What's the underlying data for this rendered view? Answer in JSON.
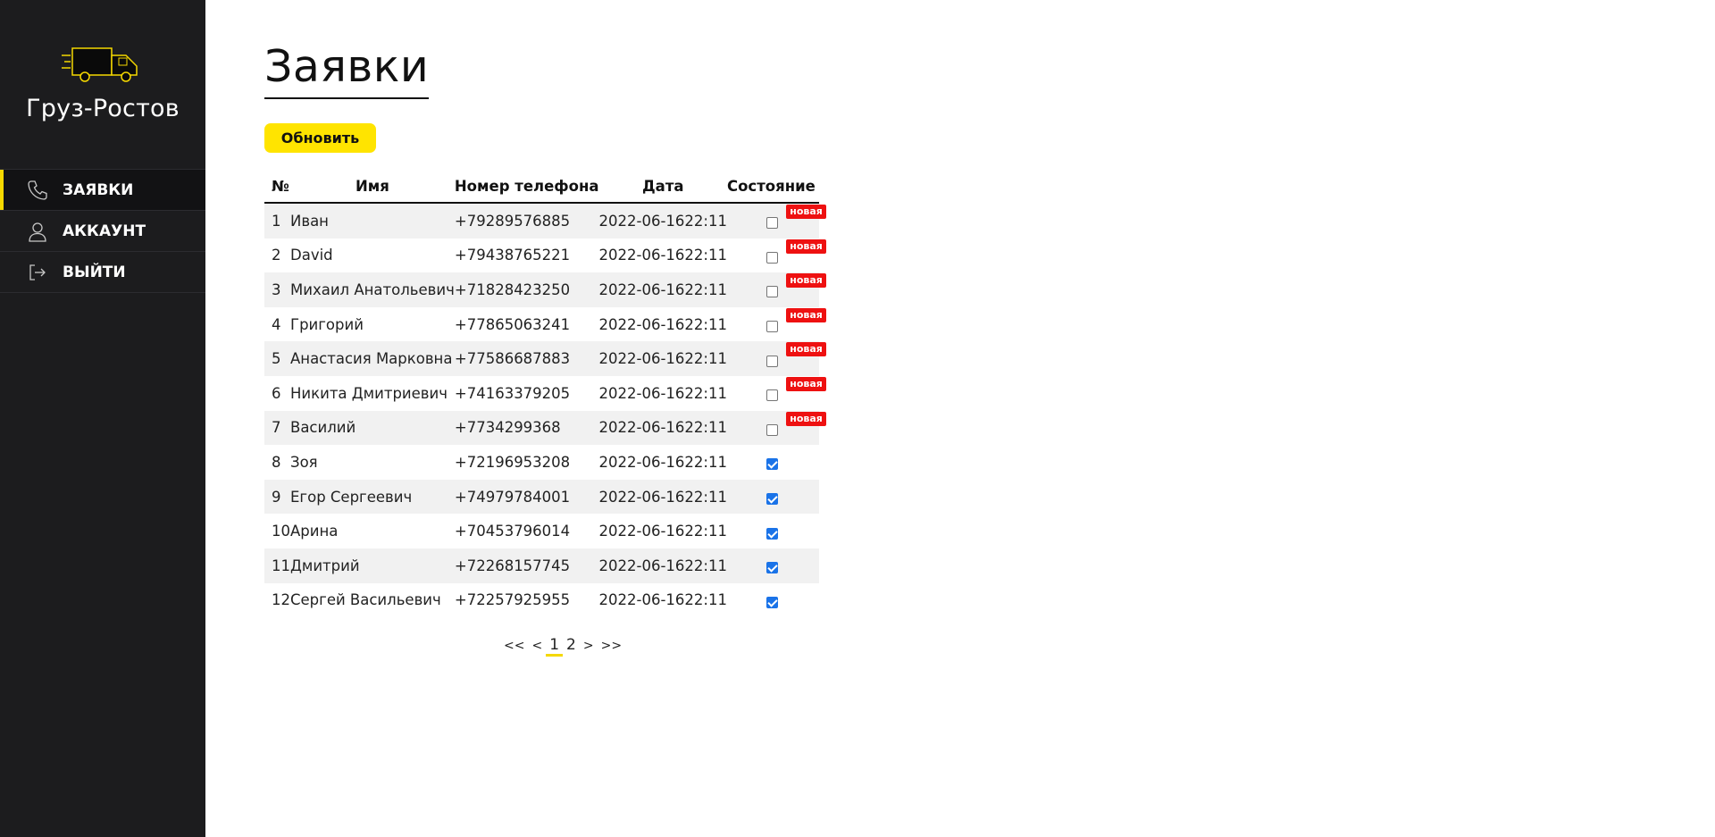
{
  "app": {
    "brand_name": "Груз-Ростов",
    "accent_color": "#f5d800",
    "sidebar_bg": "#1c1c1e"
  },
  "sidebar": {
    "items": [
      {
        "label": "ЗАЯВКИ",
        "icon": "phone-icon",
        "active": true
      },
      {
        "label": "АККАУНТ",
        "icon": "user-icon",
        "active": false
      },
      {
        "label": "ВЫЙТИ",
        "icon": "logout-icon",
        "active": false
      }
    ]
  },
  "main": {
    "title": "Заявки",
    "refresh_label": "Обновить",
    "table": {
      "headers": {
        "num": "№",
        "name": "Имя",
        "phone": "Номер телефона",
        "date": "Дата",
        "state": "Состояние"
      },
      "new_badge_label": "новая",
      "rows": [
        {
          "num": "1",
          "name": "Иван",
          "phone": "+79289576885",
          "date": "2022-06-16",
          "time": "22:11",
          "done": false
        },
        {
          "num": "2",
          "name": "David",
          "phone": "+79438765221",
          "date": "2022-06-16",
          "time": "22:11",
          "done": false
        },
        {
          "num": "3",
          "name": "Михаил Анатольевич",
          "phone": "+71828423250",
          "date": "2022-06-16",
          "time": "22:11",
          "done": false
        },
        {
          "num": "4",
          "name": "Григорий",
          "phone": "+77865063241",
          "date": "2022-06-16",
          "time": "22:11",
          "done": false
        },
        {
          "num": "5",
          "name": "Анастасия Марковна",
          "phone": "+77586687883",
          "date": "2022-06-16",
          "time": "22:11",
          "done": false
        },
        {
          "num": "6",
          "name": "Никита Дмитриевич",
          "phone": "+74163379205",
          "date": "2022-06-16",
          "time": "22:11",
          "done": false
        },
        {
          "num": "7",
          "name": "Василий",
          "phone": "+7734299368",
          "date": "2022-06-16",
          "time": "22:11",
          "done": false
        },
        {
          "num": "8",
          "name": "Зоя",
          "phone": "+72196953208",
          "date": "2022-06-16",
          "time": "22:11",
          "done": true
        },
        {
          "num": "9",
          "name": "Егор Сергеевич",
          "phone": "+74979784001",
          "date": "2022-06-16",
          "time": "22:11",
          "done": true
        },
        {
          "num": "10",
          "name": "Арина",
          "phone": "+70453796014",
          "date": "2022-06-16",
          "time": "22:11",
          "done": true
        },
        {
          "num": "11",
          "name": "Дмитрий",
          "phone": "+72268157745",
          "date": "2022-06-16",
          "time": "22:11",
          "done": true
        },
        {
          "num": "12",
          "name": "Сергей Васильевич",
          "phone": "+72257925955",
          "date": "2022-06-16",
          "time": "22:11",
          "done": true
        }
      ]
    },
    "pagination": {
      "first": "<<",
      "prev": "<",
      "pages": [
        "1",
        "2"
      ],
      "current": "1",
      "next": ">",
      "last": ">>"
    }
  }
}
